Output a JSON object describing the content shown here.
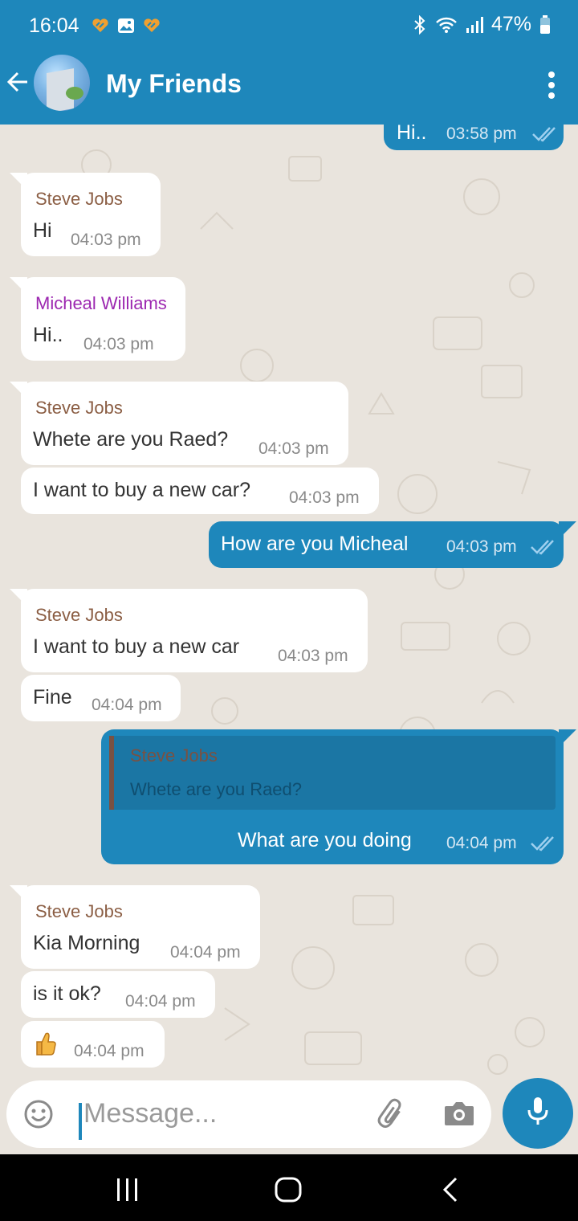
{
  "status": {
    "time": "16:04",
    "battery": "47%"
  },
  "header": {
    "title": "My Friends"
  },
  "colors": {
    "accent": "#1e87bb",
    "sender_brown": "#8b5e44",
    "sender_purple": "#9c27b0"
  },
  "messages": [
    {
      "type": "out",
      "text": "Hi..",
      "time": "03:58 pm",
      "ticks": "double-check-icon"
    },
    {
      "type": "in",
      "sender": "Steve Jobs",
      "text": "Hi",
      "time": "04:03 pm"
    },
    {
      "type": "in",
      "sender": "Micheal Williams",
      "text": "Hi..",
      "time": "04:03 pm"
    },
    {
      "type": "in",
      "sender": "Steve Jobs",
      "text": "Whete are you Raed?",
      "time": "04:03 pm"
    },
    {
      "type": "in",
      "text": "I want to buy a new car?",
      "time": "04:03 pm"
    },
    {
      "type": "out",
      "text": "How are you Micheal",
      "time": "04:03 pm",
      "ticks": "double-check-icon"
    },
    {
      "type": "in",
      "sender": "Steve Jobs",
      "text": "I want to buy a new car",
      "time": "04:03 pm"
    },
    {
      "type": "in",
      "text": "Fine",
      "time": "04:04 pm"
    },
    {
      "type": "out",
      "reply_sender": "Steve Jobs",
      "reply_text": "Whete are you Raed?",
      "text": "What are you doing",
      "time": "04:04 pm",
      "ticks": "double-check-icon"
    },
    {
      "type": "in",
      "sender": "Steve Jobs",
      "text": "Kia Morning",
      "time": "04:04 pm"
    },
    {
      "type": "in",
      "text": "is it ok?",
      "time": "04:04 pm"
    },
    {
      "type": "in",
      "text": "",
      "emoji": "thumbs-up-icon",
      "time": "04:04 pm"
    }
  ],
  "input": {
    "placeholder": "Message..."
  }
}
